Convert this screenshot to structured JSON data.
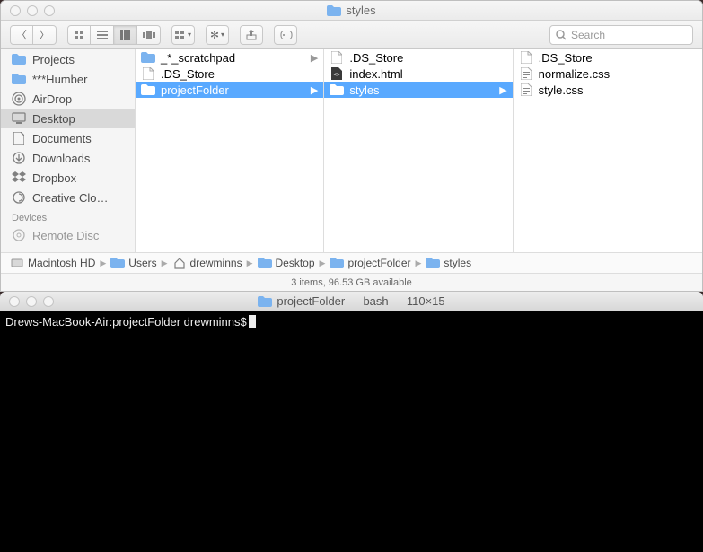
{
  "finder": {
    "title": "styles",
    "search_placeholder": "Search",
    "sidebar": {
      "favorites": [
        {
          "icon": "folder",
          "label": "Projects"
        },
        {
          "icon": "folder",
          "label": "***Humber"
        },
        {
          "icon": "airdrop",
          "label": "AirDrop"
        },
        {
          "icon": "desktop",
          "label": "Desktop",
          "selected": true
        },
        {
          "icon": "doc",
          "label": "Documents"
        },
        {
          "icon": "download",
          "label": "Downloads"
        },
        {
          "icon": "dropbox",
          "label": "Dropbox"
        },
        {
          "icon": "cloud",
          "label": "Creative Clo…"
        }
      ],
      "devices_header": "Devices",
      "devices": [
        {
          "icon": "disc",
          "label": "Remote Disc"
        }
      ]
    },
    "columns": [
      [
        {
          "icon": "folder",
          "label": "_*_scratchpad",
          "arrow": true
        },
        {
          "icon": "file",
          "label": ".DS_Store"
        },
        {
          "icon": "folder",
          "label": "projectFolder",
          "arrow": true,
          "selected": true
        }
      ],
      [
        {
          "icon": "file",
          "label": ".DS_Store"
        },
        {
          "icon": "html",
          "label": "index.html"
        },
        {
          "icon": "folder",
          "label": "styles",
          "arrow": true,
          "selected": true
        }
      ],
      [
        {
          "icon": "file",
          "label": ".DS_Store"
        },
        {
          "icon": "css",
          "label": "normalize.css"
        },
        {
          "icon": "css",
          "label": "style.css"
        }
      ]
    ],
    "path": [
      {
        "icon": "hd",
        "label": "Macintosh HD"
      },
      {
        "icon": "folder",
        "label": "Users"
      },
      {
        "icon": "home",
        "label": "drewminns"
      },
      {
        "icon": "folder",
        "label": "Desktop"
      },
      {
        "icon": "folder",
        "label": "projectFolder"
      },
      {
        "icon": "folder",
        "label": "styles"
      }
    ],
    "status": "3 items, 96.53 GB available"
  },
  "terminal": {
    "title": "projectFolder — bash — 110×15",
    "prompt": "Drews-MacBook-Air:projectFolder drewminns$"
  }
}
